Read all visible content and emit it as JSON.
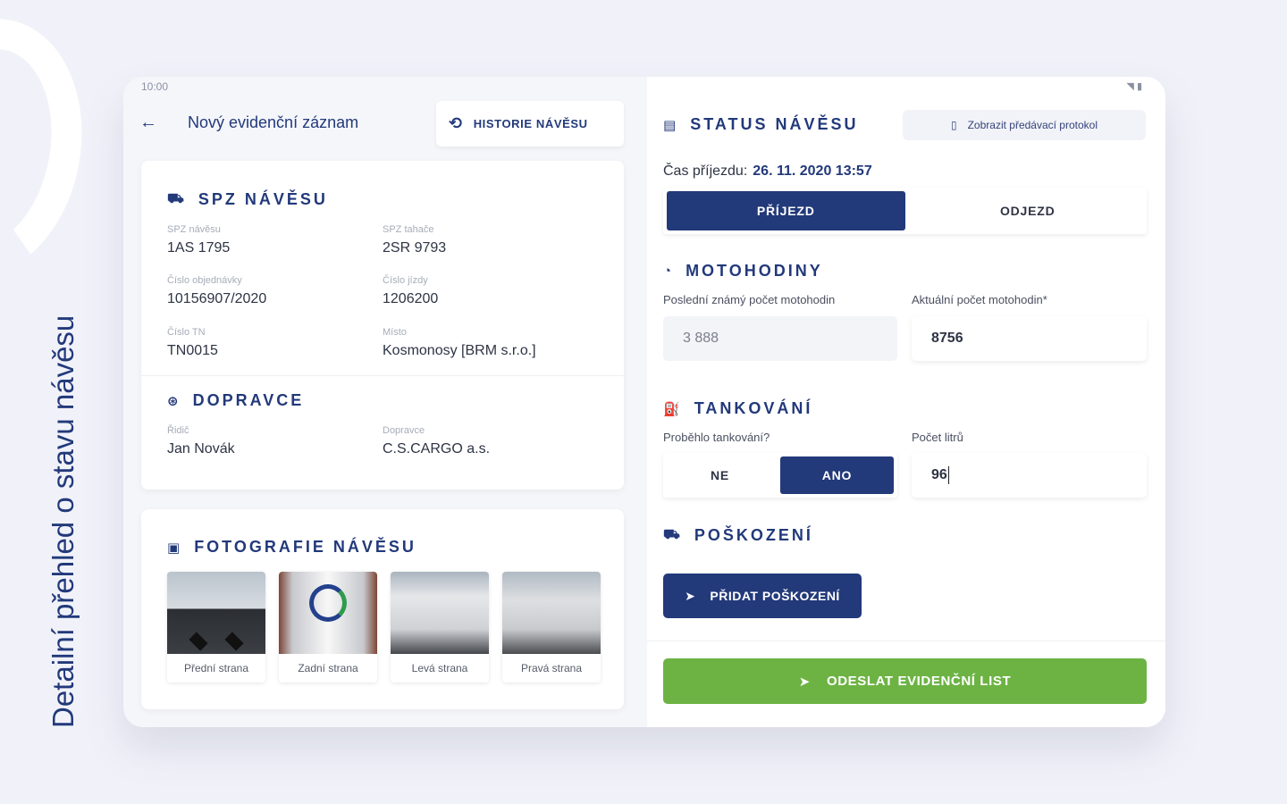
{
  "side_caption": "Detailní přehled o stavu návěsu",
  "status_bar": {
    "time": "10:00"
  },
  "header": {
    "back_icon": "arrow-left-icon",
    "title": "Nový evidenční záznam",
    "history_button": {
      "label": "HISTORIE NÁVĚSU",
      "icon": "history-icon"
    }
  },
  "spz": {
    "title": "SPZ NÁVĚSU",
    "icon": "truck-icon",
    "fields": [
      {
        "label": "SPZ návěsu",
        "value": "1AS 1795"
      },
      {
        "label": "SPZ tahače",
        "value": "2SR 9793"
      },
      {
        "label": "Číslo objednávky",
        "value": "10156907/2020"
      },
      {
        "label": "Číslo jízdy",
        "value": "1206200"
      },
      {
        "label": "Číslo TN",
        "value": "TN0015"
      },
      {
        "label": "Místo",
        "value": "Kosmonosy [BRM s.r.o.]"
      }
    ]
  },
  "dopravce": {
    "title": "DOPRAVCE",
    "icon": "steering-wheel-icon",
    "fields": [
      {
        "label": "Řidič",
        "value": "Jan Novák"
      },
      {
        "label": "Dopravce",
        "value": "C.S.CARGO a.s."
      }
    ]
  },
  "photos": {
    "title": "FOTOGRAFIE NÁVĚSU",
    "icon": "photo-icon",
    "items": [
      {
        "caption": "Přední strana"
      },
      {
        "caption": "Zadní strana"
      },
      {
        "caption": "Levá strana"
      },
      {
        "caption": "Pravá strana"
      }
    ]
  },
  "status": {
    "title": "STATUS NÁVĚSU",
    "icon": "monitor-icon",
    "protocol_button": {
      "label": "Zobrazit předávací protokol",
      "icon": "document-icon"
    },
    "arrival_label": "Čas příjezdu:",
    "arrival_value": "26. 11. 2020 13:57",
    "toggle": {
      "options": [
        "PŘÍJEZD",
        "ODJEZD"
      ],
      "selected": "PŘÍJEZD"
    }
  },
  "motohodiny": {
    "title": "MOTOHODINY",
    "icon": "gauge-icon",
    "last_label": "Poslední známý počet motohodin",
    "last_value": "3 888",
    "current_label": "Aktuální počet motohodin*",
    "current_value": "8756"
  },
  "tankovani": {
    "title": "TANKOVÁNÍ",
    "icon": "fuel-icon",
    "question_label": "Proběhlo tankování?",
    "options": [
      "NE",
      "ANO"
    ],
    "selected": "ANO",
    "liters_label": "Počet litrů",
    "liters_value": "96"
  },
  "poskozeni": {
    "title": "POŠKOZENÍ",
    "icon": "truck-damage-icon",
    "add_button": {
      "label": "PŘIDAT POŠKOZENÍ",
      "icon": "send-icon"
    }
  },
  "submit_button": {
    "label": "ODESLAT EVIDENČNÍ LIST",
    "icon": "send-icon"
  },
  "colors": {
    "primary": "#22397a",
    "success": "#6db344",
    "background": "#f1f2f9"
  }
}
